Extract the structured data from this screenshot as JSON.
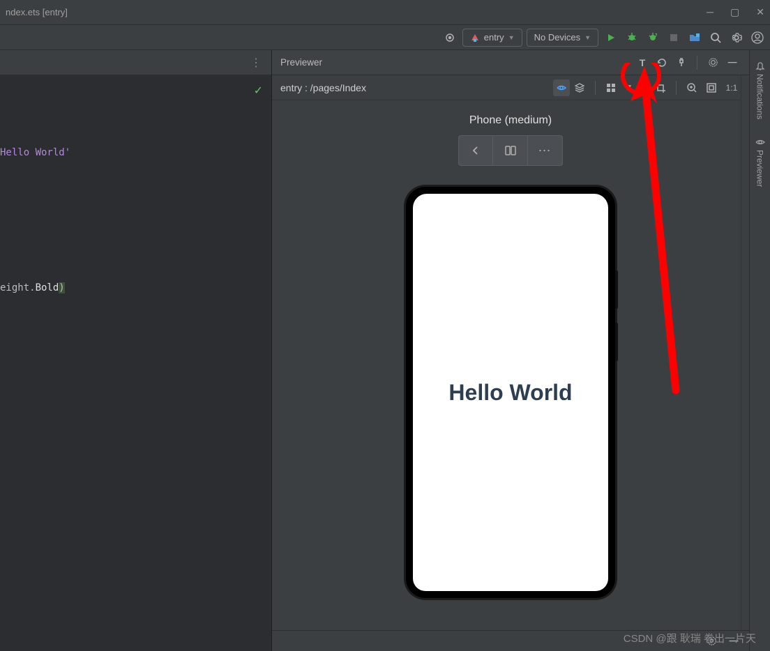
{
  "titlebar": {
    "filename": "ndex.ets [entry]"
  },
  "toolbar": {
    "entry_label": "entry",
    "device_label": "No Devices"
  },
  "editor": {
    "string_text": "Hello World'",
    "code_frag": "eight.Bold)"
  },
  "previewer": {
    "title": "Previewer",
    "breadcrumb": "entry : /pages/Index",
    "device_label": "Phone (medium)",
    "screen_text": "Hello World",
    "ratio_label": "1:1"
  },
  "sidebar": {
    "notifications": "Notifications",
    "previewer": "Previewer"
  },
  "watermark": "CSDN @跟 耿瑞 卷出一片天"
}
